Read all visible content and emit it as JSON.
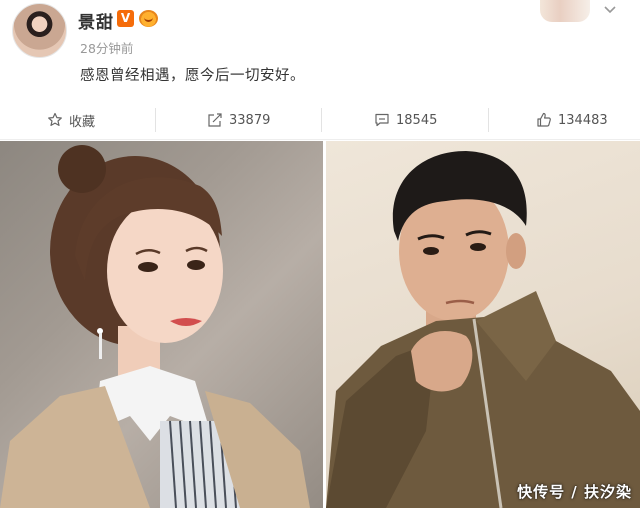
{
  "post": {
    "username": "景甜",
    "vip_badge": "V",
    "timestamp": "28分钟前",
    "text": "感恩曾经相遇，愿今后一切安好。"
  },
  "actions": {
    "favorite_label": "收藏",
    "repost_count": "33879",
    "comment_count": "18545",
    "like_count": "134483"
  },
  "icons": [
    "star-icon",
    "repost-icon",
    "comment-icon",
    "like-icon",
    "chevron-down-icon"
  ],
  "watermark": "快传号 / 扶汐染",
  "colors": {
    "vip_badge": "#f56c0a",
    "meta_text": "#999999",
    "body_text": "#333333"
  }
}
